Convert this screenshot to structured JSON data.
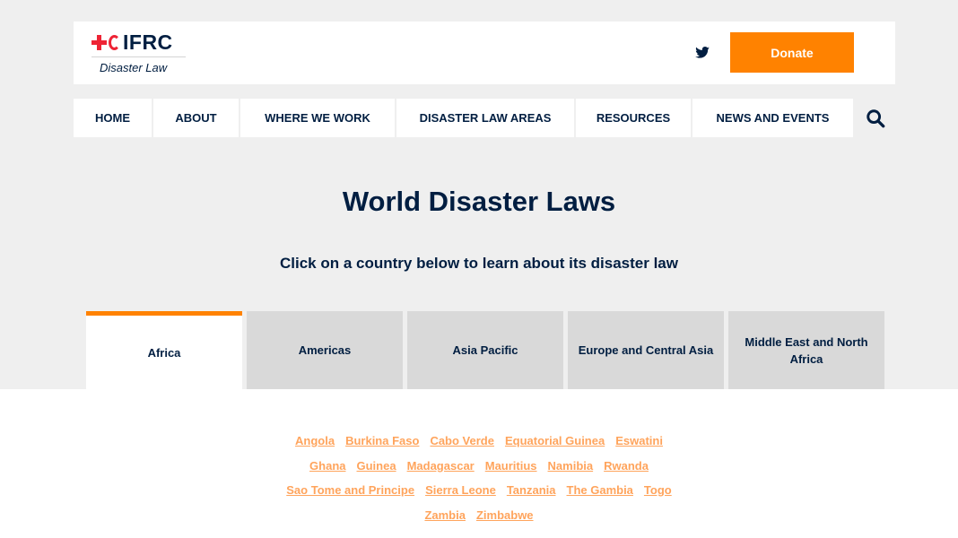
{
  "header": {
    "logo_text": "IFRC",
    "logo_subtitle": "Disaster Law",
    "twitter_icon": "twitter-icon",
    "donate_label": "Donate",
    "donate_color": "#ff8200"
  },
  "nav": {
    "items": [
      "HOME",
      "ABOUT",
      "WHERE WE WORK",
      "DISASTER LAW AREAS",
      "RESOURCES",
      "NEWS AND EVENTS"
    ],
    "search_icon": "search-icon"
  },
  "main": {
    "title": "World Disaster Laws",
    "subtitle": "Click on a country below to learn about its disaster law"
  },
  "tabs": [
    {
      "label": "Africa",
      "active": true
    },
    {
      "label": "Americas",
      "active": false
    },
    {
      "label": "Asia Pacific",
      "active": false
    },
    {
      "label": "Europe and Central Asia",
      "active": false
    },
    {
      "label": "Middle East and North Africa",
      "active": false
    }
  ],
  "countries": [
    [
      "Angola",
      "Burkina Faso",
      "Cabo Verde",
      "Equatorial Guinea",
      "Eswatini"
    ],
    [
      "Ghana",
      "Guinea",
      "Madagascar",
      "Mauritius",
      "Namibia",
      "Rwanda"
    ],
    [
      "Sao Tome and Principe",
      "Sierra Leone",
      "Tanzania",
      "The Gambia",
      "Togo"
    ],
    [
      "Zambia",
      "Zimbabwe"
    ]
  ],
  "colors": {
    "accent": "#ff8200",
    "navy": "#011e41",
    "link": "#ffa45c",
    "brand_red": "#ee2435"
  }
}
